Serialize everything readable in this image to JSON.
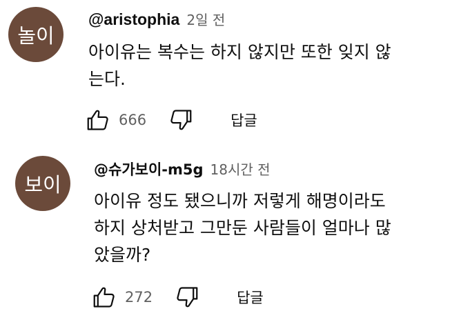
{
  "comments": [
    {
      "avatar_text": "놀이",
      "avatar_color": "#6b4a3a",
      "handle": "@aristophia",
      "time": "2일 전",
      "body_lines": [
        "아이유는 복수는 하지 않지만 또한 잊지 않",
        "는다."
      ],
      "like_count": "666",
      "reply_label": "답글",
      "like_icon": "thumbs-up-icon",
      "dislike_icon": "thumbs-down-icon"
    },
    {
      "avatar_text": "보이",
      "avatar_color": "#6b4a3a",
      "handle": "@슈가보이-m5g",
      "time": "18시간 전",
      "body_lines": [
        "아이유 정도 됐으니까 저렇게 해명이라도",
        "하지 상처받고 그만둔 사람들이 얼마나 많",
        "았을까?"
      ],
      "like_count": "272",
      "reply_label": "답글",
      "like_icon": "thumbs-up-icon",
      "dislike_icon": "thumbs-down-icon"
    }
  ]
}
